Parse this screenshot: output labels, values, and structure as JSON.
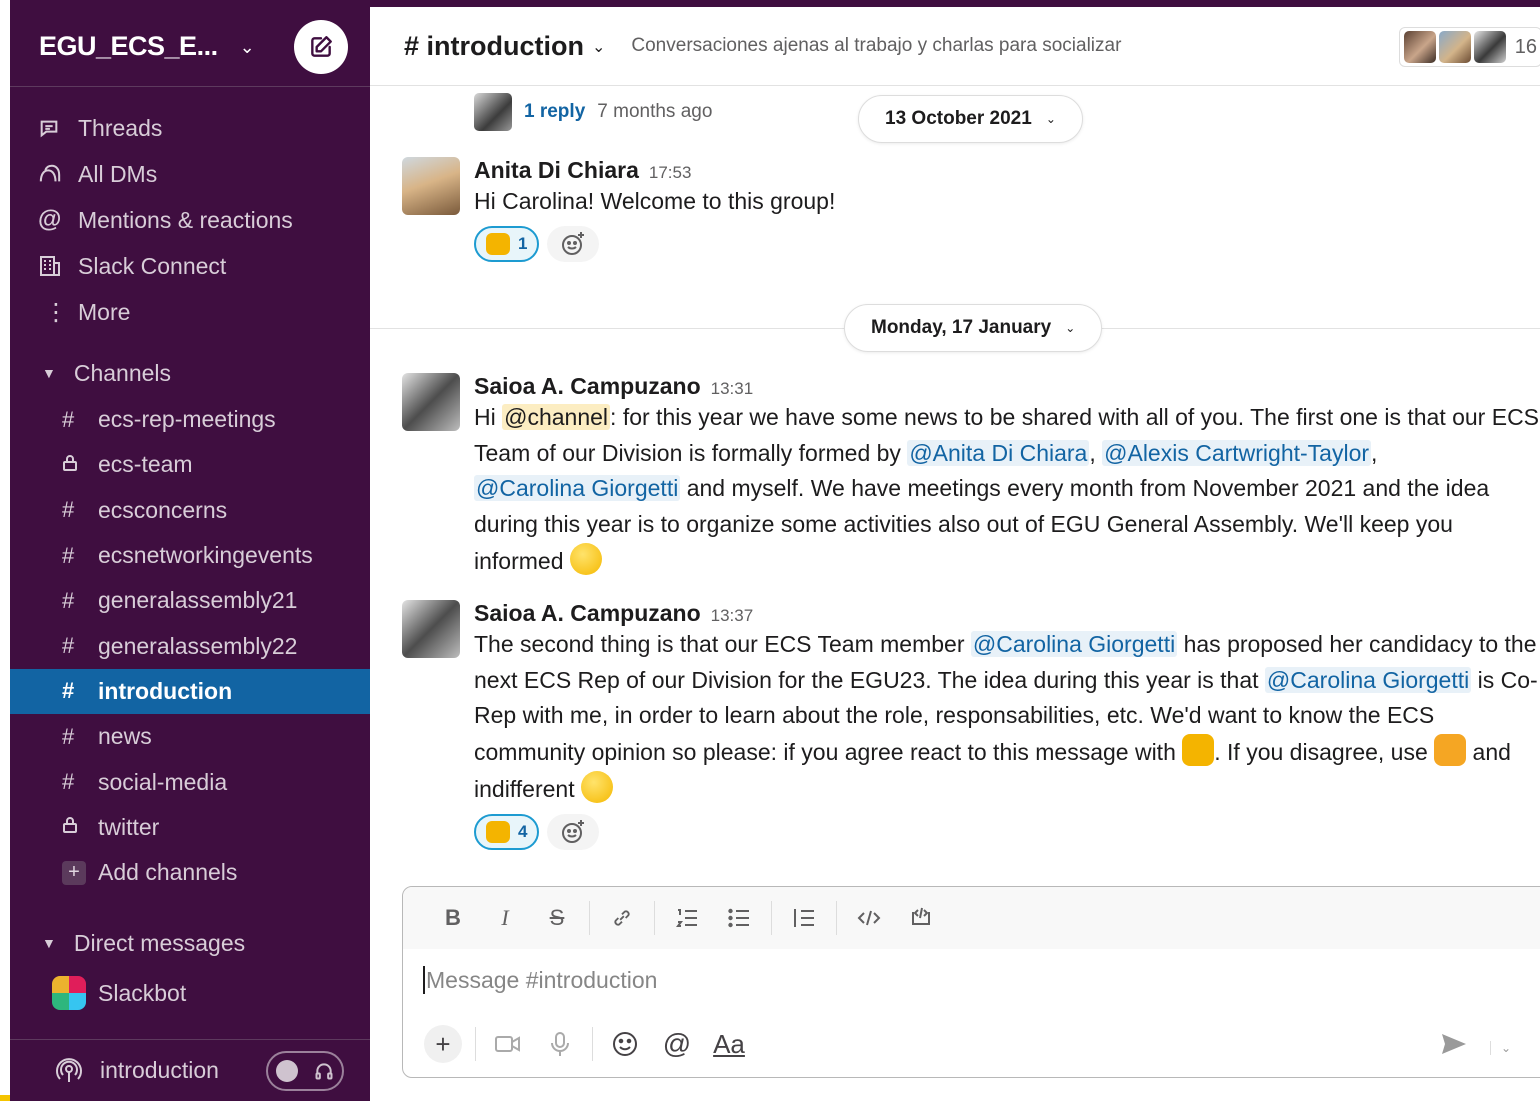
{
  "workspace": {
    "name": "EGU_ECS_E...",
    "compose_icon": "compose-icon"
  },
  "nav": [
    {
      "label": "Threads",
      "icon": "threads-icon"
    },
    {
      "label": "All DMs",
      "icon": "dms-icon"
    },
    {
      "label": "Mentions & reactions",
      "icon": "at-icon"
    },
    {
      "label": "Slack Connect",
      "icon": "building-icon"
    },
    {
      "label": "More",
      "icon": "more-vertical-icon"
    }
  ],
  "channels_section": {
    "title": "Channels",
    "items": [
      {
        "prefix": "#",
        "label": "ecs-rep-meetings"
      },
      {
        "prefix": "lock",
        "label": "ecs-team"
      },
      {
        "prefix": "#",
        "label": "ecsconcerns"
      },
      {
        "prefix": "#",
        "label": "ecsnetworkingevents"
      },
      {
        "prefix": "#",
        "label": "generalassembly21"
      },
      {
        "prefix": "#",
        "label": "generalassembly22"
      },
      {
        "prefix": "#",
        "label": "introduction",
        "active": true
      },
      {
        "prefix": "#",
        "label": "news"
      },
      {
        "prefix": "#",
        "label": "social-media"
      },
      {
        "prefix": "lock",
        "label": "twitter"
      }
    ],
    "add_label": "Add channels"
  },
  "dm_section": {
    "title": "Direct messages",
    "items": [
      {
        "label": "Slackbot"
      }
    ]
  },
  "huddle": {
    "label": "introduction"
  },
  "channel": {
    "title": "# introduction",
    "topic": "Conversaciones ajenas al trabajo y charlas para socializar",
    "member_count": "16"
  },
  "thread_reply": {
    "link": "1 reply",
    "time": "7 months ago"
  },
  "date_pills": {
    "first": "13 October 2021",
    "second": "Monday, 17 January"
  },
  "messages": [
    {
      "author": "Anita Di Chiara",
      "time": "17:53",
      "text": "Hi Carolina! Welcome to this group!",
      "reaction_count": "1"
    },
    {
      "author": "Saioa A. Campuzano",
      "time": "13:31",
      "p1": "Hi ",
      "channel_mention": "@channel",
      "p2": ": for this year we have some news to be shared with all of you. The first one is that our ECS Team of our Division is formally formed by ",
      "m1": "@Anita Di Chiara",
      "sep1": ", ",
      "m2": "@Alexis Cartwright-Taylor",
      "sep2": ",",
      "m3": "@Carolina Giorgetti",
      "p3": " and myself. We have meetings every month from November 2021 and the idea during this year is to organize some activities also out of EGU General Assembly. We'll keep you informed "
    },
    {
      "author": "Saioa A. Campuzano",
      "time": "13:37",
      "p1": "The second thing is that our ECS Team member ",
      "m1": "@Carolina Giorgetti",
      "p2": " has proposed her candidacy to the next ECS Rep of our Division for the EGU23. The idea during this year is that ",
      "m2": "@Carolina Giorgetti",
      "p3": " is Co-Rep with me, in order to learn about the role, responsabilities, etc. We'd want to know the ECS community opinion so please: if you agree react to this message with ",
      "p4": ". If you disagree, use ",
      "p5": " and indifferent ",
      "reaction_count": "4"
    }
  ],
  "composer": {
    "placeholder": "Message #introduction",
    "format_buttons": [
      "B",
      "I",
      "S"
    ],
    "aa_label": "Aa"
  },
  "colors": {
    "sidebar": "#3f0e40",
    "active": "#1264a3",
    "mention": "#1264a3"
  }
}
